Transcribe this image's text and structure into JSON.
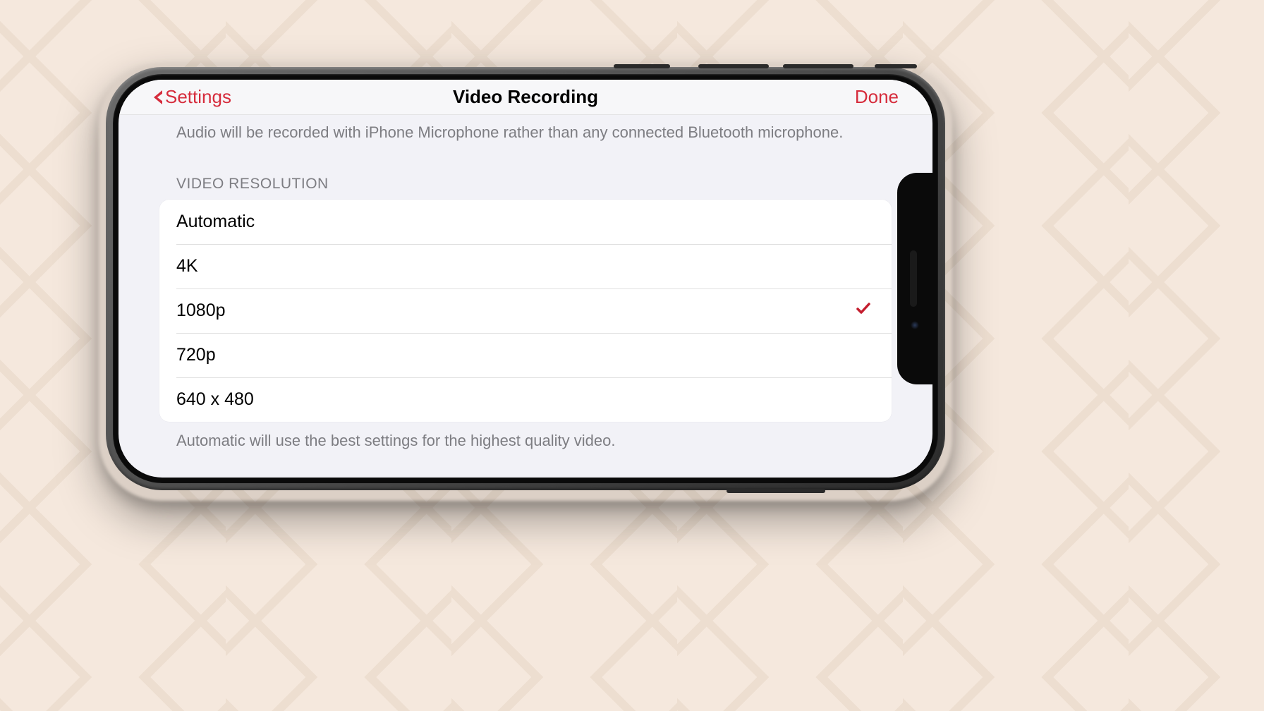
{
  "nav": {
    "back_label": "Settings",
    "title": "Video Recording",
    "done_label": "Done"
  },
  "audio_hint": "Audio will be recorded with iPhone Microphone rather than any connected Bluetooth microphone.",
  "section_header": "VIDEO RESOLUTION",
  "resolutions": [
    {
      "label": "Automatic",
      "selected": false
    },
    {
      "label": "4K",
      "selected": false
    },
    {
      "label": "1080p",
      "selected": true
    },
    {
      "label": "720p",
      "selected": false
    },
    {
      "label": "640 x 480",
      "selected": false
    }
  ],
  "footer_hint": "Automatic will use the best settings for the highest quality video.",
  "colors": {
    "accent": "#d62c3c",
    "background": "#f2f2f7",
    "text_secondary": "#7d7d82"
  }
}
